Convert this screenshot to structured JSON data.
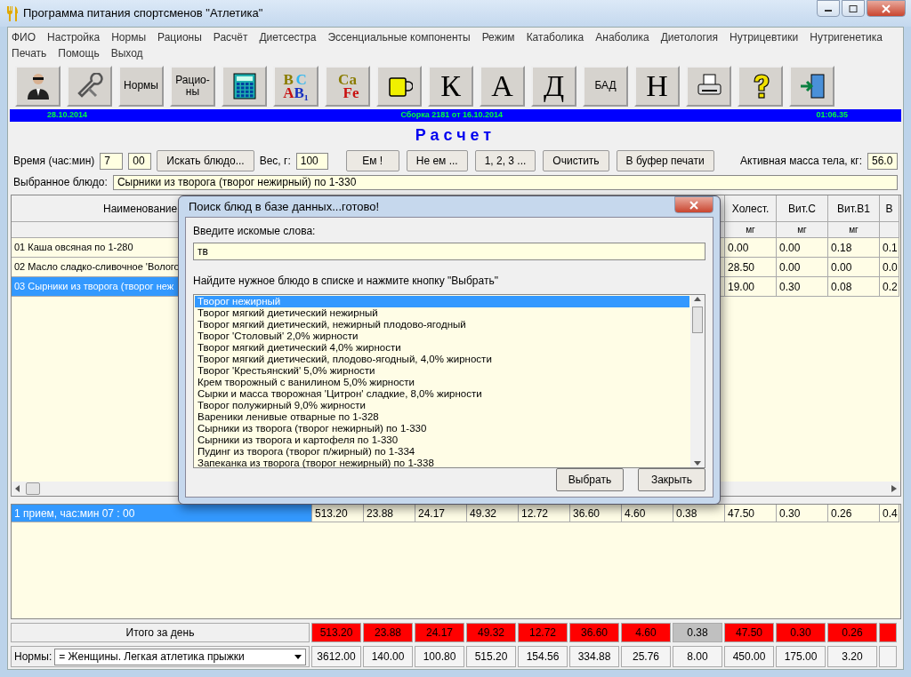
{
  "window": {
    "title": "Программа питания спортсменов \"Атлетика\""
  },
  "menu": [
    [
      "ФИО",
      "Настройка",
      "Нормы",
      "Рационы",
      "Расчёт",
      "Диетсестра",
      "Эссенциальные компоненты",
      "Режим",
      "Катаболика",
      "Анаболика",
      "Диетология",
      "Нутрицевтики",
      "Нутригенетика"
    ],
    [
      "Печать",
      "Помощь",
      "Выход"
    ]
  ],
  "toolbar": [
    {
      "kind": "person"
    },
    {
      "kind": "tools"
    },
    {
      "kind": "text",
      "label": "Нормы"
    },
    {
      "kind": "text",
      "label": "Рацио-\nны"
    },
    {
      "kind": "calculator"
    },
    {
      "kind": "letters",
      "letters": [
        {
          "text": "B",
          "color": "#8a7c00"
        },
        {
          "text": "C",
          "color": "#30b8f0"
        },
        {
          "text": "A",
          "color": "#c81010"
        },
        {
          "text": "B₁",
          "color": "#1830c0"
        }
      ]
    },
    {
      "kind": "letters",
      "letters": [
        {
          "text": "Ca",
          "color": "#8a7c00"
        },
        {
          "text": "Fe",
          "color": "#c81010"
        }
      ]
    },
    {
      "kind": "mug"
    },
    {
      "kind": "big",
      "label": "К"
    },
    {
      "kind": "big",
      "label": "А"
    },
    {
      "kind": "big",
      "label": "Д"
    },
    {
      "kind": "text",
      "label": "БАД"
    },
    {
      "kind": "big",
      "label": "Н"
    },
    {
      "kind": "printer"
    },
    {
      "kind": "help"
    },
    {
      "kind": "exit"
    }
  ],
  "status_bar": {
    "date": "28.10.2014",
    "build": "Сборка 2181 от 16.10.2014",
    "time": "01:06.35"
  },
  "heading": "Расчет",
  "controls": {
    "time_label": "Время (час:мин)",
    "hour": "7",
    "minute": "00",
    "search_button": "Искать блюдо...",
    "weight_label": "Вес, г:",
    "weight": "100",
    "buttons": [
      "Ем !",
      "Не ем ...",
      "1, 2, 3 ...",
      "Очистить",
      "В буфер печати"
    ],
    "mass_label": "Активная масса тела, кг:",
    "mass": "56.0",
    "selected_label": "Выбранное блюдо:",
    "selected_dish": "Сырники из творога (творог нежирный) по 1-330"
  },
  "table": {
    "name_header": "Наименование",
    "columns": [
      {
        "header": "Холест.",
        "unit": "мг"
      },
      {
        "header": "Вит.С",
        "unit": "мг"
      },
      {
        "header": "Вит.В1",
        "unit": "мг"
      },
      {
        "header": "В"
      }
    ],
    "rows": [
      {
        "name": "01 Каша овсяная по 1-280",
        "selected": false,
        "values": [
          "0.00",
          "0.00",
          "0.18",
          "0.1"
        ]
      },
      {
        "name": "02 Масло сладко-сливочное 'Волого",
        "selected": false,
        "values": [
          "28.50",
          "0.00",
          "0.00",
          "0.0"
        ]
      },
      {
        "name": "03 Сырники из творога (творог неж",
        "selected": true,
        "values": [
          "19.00",
          "0.30",
          "0.08",
          "0.2"
        ]
      }
    ]
  },
  "meal": {
    "label": "1 прием, час:мин  07 : 00",
    "selected": true,
    "values": [
      "513.20",
      "23.88",
      "24.17",
      "49.32",
      "12.72",
      "36.60",
      "4.60",
      "0.38",
      "47.50",
      "0.30",
      "0.26",
      "0.4"
    ]
  },
  "totals": {
    "label": "Итого за день",
    "cells": [
      {
        "value": "513.20",
        "exceeded": true
      },
      {
        "value": "23.88",
        "exceeded": true
      },
      {
        "value": "24.17",
        "exceeded": true
      },
      {
        "value": "49.32",
        "exceeded": true
      },
      {
        "value": "12.72",
        "exceeded": true
      },
      {
        "value": "36.60",
        "exceeded": true
      },
      {
        "value": "4.60",
        "exceeded": true
      },
      {
        "value": "0.38",
        "exceeded": false
      },
      {
        "value": "47.50",
        "exceeded": true
      },
      {
        "value": "0.30",
        "exceeded": true
      },
      {
        "value": "0.26",
        "exceeded": true
      },
      {
        "exceeded": true
      }
    ]
  },
  "norms": {
    "label": "Нормы:",
    "selected": "= Женщины. Легкая атлетика прыжки",
    "values": [
      "3612.00",
      "140.00",
      "100.80",
      "515.20",
      "154.56",
      "334.88",
      "25.76",
      "8.00",
      "450.00",
      "175.00",
      "3.20"
    ]
  },
  "dialog": {
    "title": "Поиск блюд в базе данных...готово!",
    "search_label": "Введите искомые слова:",
    "search_value": "тв",
    "list_label": "Найдите нужное блюдо в списке и нажмите кнопку \"Выбрать\"",
    "items": [
      {
        "text": "Творог нежирный",
        "selected": true
      },
      {
        "text": "Творог мягкий диетический нежирный",
        "selected": false
      },
      {
        "text": "Творог мягкий диетический, нежирный плодово-ягодный",
        "selected": false
      },
      {
        "text": "Творог 'Столовый' 2,0% жирности",
        "selected": false
      },
      {
        "text": "Творог мягкий диетический 4,0% жирности",
        "selected": false
      },
      {
        "text": "Творог мягкий диетический, плодово-ягодный, 4,0% жирности",
        "selected": false
      },
      {
        "text": "Творог 'Крестьянский' 5,0% жирности",
        "selected": false
      },
      {
        "text": "Крем творожный с ванилином 5,0% жирности",
        "selected": false
      },
      {
        "text": "Сырки и масса творожная 'Цитрон' сладкие, 8,0% жирности",
        "selected": false
      },
      {
        "text": "Творог полужирный 9,0% жирности",
        "selected": false
      },
      {
        "text": "Вареники ленивые отварные по 1-328",
        "selected": false
      },
      {
        "text": "Сырники из творога (творог нежирный) по 1-330",
        "selected": false
      },
      {
        "text": "Сырники из творога и картофеля по 1-330",
        "selected": false
      },
      {
        "text": "Пудинг из творога (творог п/жирный) по 1-334",
        "selected": false
      },
      {
        "text": "Запеканка из творога (творог нежирный) по 1-338",
        "selected": false
      }
    ],
    "buttons": [
      "Выбрать",
      "Закрыть"
    ]
  }
}
